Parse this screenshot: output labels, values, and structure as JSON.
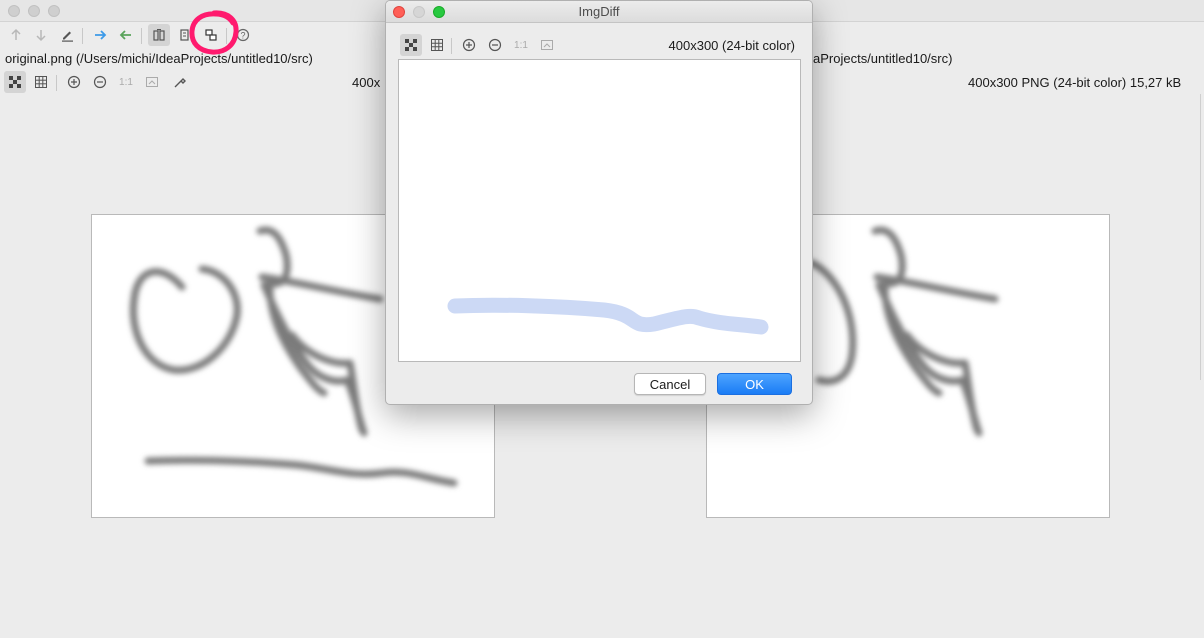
{
  "main_window": {
    "left_path": "original.png (/Users/michi/IdeaProjects/untitled10/src)",
    "right_path": "aProjects/untitled10/src)",
    "left_info": "400x",
    "right_info": "400x300 PNG (24-bit color) 15,27 kB"
  },
  "toolbar": {
    "buttons": [
      {
        "icon": "arrow-up-icon",
        "enabled": false
      },
      {
        "icon": "arrow-down-icon",
        "enabled": false
      },
      {
        "icon": "pencil-icon",
        "enabled": true
      },
      {
        "icon": "arrow-right-icon",
        "color": "#3d9ae8"
      },
      {
        "icon": "arrow-left-icon",
        "color": "#5aa35b"
      },
      {
        "icon": "side-by-side-icon",
        "active": true
      },
      {
        "icon": "unified-icon"
      },
      {
        "icon": "diff-overlay-icon",
        "highlighted": true
      },
      {
        "icon": "help-icon"
      }
    ]
  },
  "image_toolbar": {
    "buttons": [
      "chessboard-icon",
      "grid-icon",
      "zoom-in-icon",
      "zoom-out-icon",
      "actual-size-icon",
      "fit-icon",
      "color-picker-icon"
    ],
    "actual_size_label": "1:1"
  },
  "dialog": {
    "title": "ImgDiff",
    "info": "400x300  (24-bit color)",
    "actual_size_label": "1:1",
    "cancel_label": "Cancel",
    "ok_label": "OK"
  },
  "colors": {
    "highlight": "#ff1a6e",
    "diff_stroke": "#ccd9f5",
    "drawing": "#7a7a7a",
    "ok_button": "#1a7cf5"
  }
}
